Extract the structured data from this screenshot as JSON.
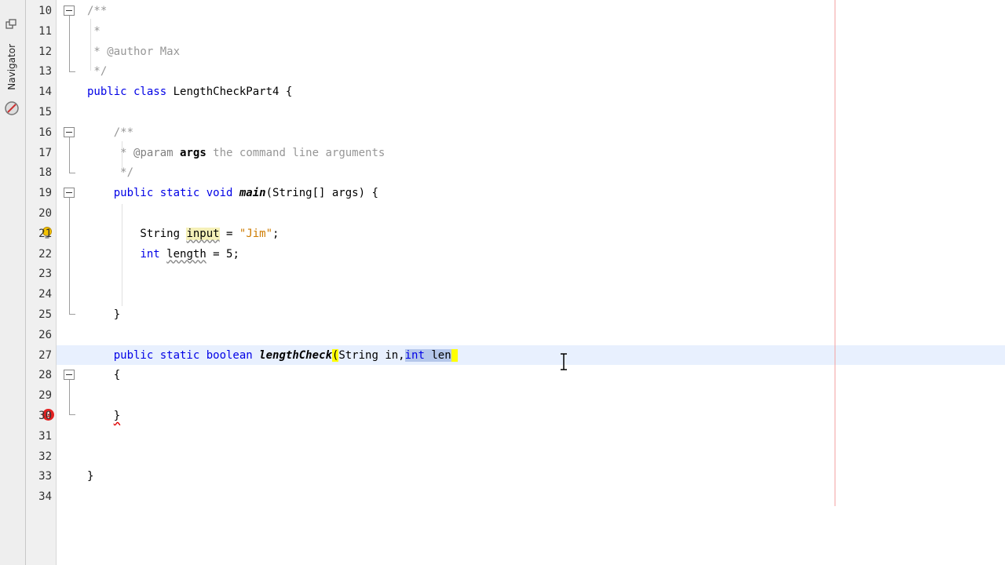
{
  "side_panel": {
    "navigator_label": "Navigator"
  },
  "editor": {
    "lines": [
      {
        "n": "10",
        "tokens": [
          {
            "t": "/**",
            "c": "cm"
          }
        ]
      },
      {
        "n": "11",
        "tokens": [
          {
            "t": " *",
            "c": "cm"
          }
        ]
      },
      {
        "n": "12",
        "tokens": [
          {
            "t": " * @author Max",
            "c": "cm"
          }
        ]
      },
      {
        "n": "13",
        "tokens": [
          {
            "t": " */",
            "c": "cm"
          }
        ]
      },
      {
        "n": "14",
        "tokens": [
          {
            "t": "public class",
            "c": "kw"
          },
          {
            "t": " LengthCheckPart4 {",
            "c": ""
          }
        ]
      },
      {
        "n": "15",
        "tokens": []
      },
      {
        "n": "16",
        "tokens": [
          {
            "t": "    /**",
            "c": "cm"
          }
        ]
      },
      {
        "n": "17",
        "tokens": [
          {
            "t": "     * ",
            "c": "cm"
          },
          {
            "t": "@param",
            "c": "tag"
          },
          {
            "t": " ",
            "c": "cm"
          },
          {
            "t": "args",
            "c": "tagv"
          },
          {
            "t": " the command line arguments",
            "c": "cm"
          }
        ]
      },
      {
        "n": "18",
        "tokens": [
          {
            "t": "     */",
            "c": "cm"
          }
        ]
      },
      {
        "n": "19",
        "tokens": [
          {
            "t": "    ",
            "c": ""
          },
          {
            "t": "public static void",
            "c": "kw"
          },
          {
            "t": " ",
            "c": ""
          },
          {
            "t": "main",
            "c": "it"
          },
          {
            "t": "(String[] args) {",
            "c": ""
          }
        ]
      },
      {
        "n": "20",
        "tokens": []
      },
      {
        "n": "21",
        "tokens": [
          {
            "t": "        String ",
            "c": ""
          },
          {
            "t": "input",
            "c": "occ wav"
          },
          {
            "t": " = ",
            "c": ""
          },
          {
            "t": "\"Jim\"",
            "c": "str"
          },
          {
            "t": ";",
            "c": ""
          }
        ]
      },
      {
        "n": "22",
        "tokens": [
          {
            "t": "        ",
            "c": ""
          },
          {
            "t": "int",
            "c": "kw"
          },
          {
            "t": " ",
            "c": ""
          },
          {
            "t": "length",
            "c": "wav"
          },
          {
            "t": " = 5;",
            "c": ""
          }
        ]
      },
      {
        "n": "23",
        "tokens": []
      },
      {
        "n": "24",
        "tokens": []
      },
      {
        "n": "25",
        "tokens": [
          {
            "t": "    }",
            "c": ""
          }
        ]
      },
      {
        "n": "26",
        "tokens": []
      },
      {
        "n": "27",
        "tokens": [
          {
            "t": "    ",
            "c": ""
          },
          {
            "t": "public static boolean",
            "c": "kw"
          },
          {
            "t": " ",
            "c": ""
          },
          {
            "t": "lengthCheck",
            "c": "it"
          },
          {
            "t": "(",
            "c": "brk"
          },
          {
            "t": "String in,",
            "c": ""
          },
          {
            "t": "int",
            "c": "kw sel"
          },
          {
            "t": " len",
            "c": "sel"
          },
          {
            "t": " ",
            "c": "brk"
          }
        ]
      },
      {
        "n": "28",
        "tokens": [
          {
            "t": "    {",
            "c": ""
          }
        ]
      },
      {
        "n": "29",
        "tokens": []
      },
      {
        "n": "30",
        "tokens": [
          {
            "t": "    ",
            "c": ""
          },
          {
            "t": "}",
            "c": "errw"
          }
        ]
      },
      {
        "n": "31",
        "tokens": []
      },
      {
        "n": "32",
        "tokens": []
      },
      {
        "n": "33",
        "tokens": [
          {
            "t": "}",
            "c": ""
          }
        ]
      },
      {
        "n": "34",
        "tokens": []
      }
    ]
  },
  "colors": {
    "keyword": "#0000e6",
    "comment": "#969696",
    "string": "#ce7b00",
    "current_line": "#e8f0fe",
    "margin_line": "#f4a4a4"
  }
}
